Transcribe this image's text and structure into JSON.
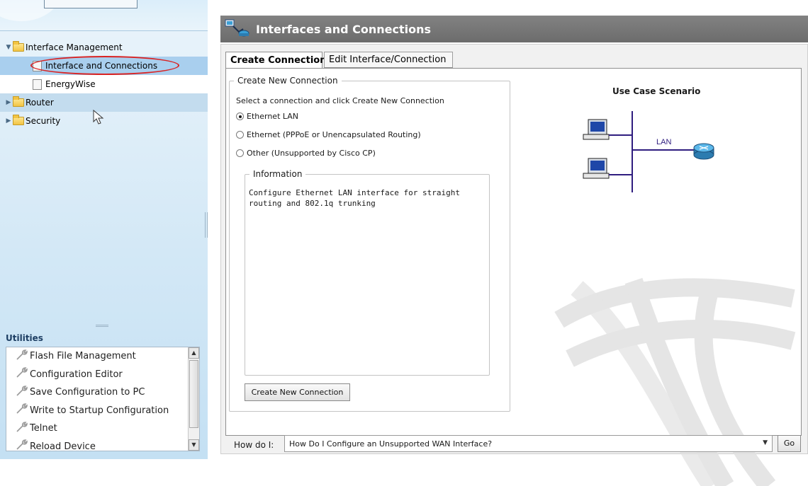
{
  "nav": {
    "tree": [
      {
        "label": "Interface Management",
        "level": 0,
        "expanded": true,
        "kind": "folder"
      },
      {
        "label": "Interface and Connections",
        "level": 1,
        "selected": true,
        "kind": "page"
      },
      {
        "label": "EnergyWise",
        "level": 1,
        "kind": "page"
      },
      {
        "label": "Router",
        "level": 0,
        "expanded": false,
        "kind": "folder"
      },
      {
        "label": "Security",
        "level": 0,
        "expanded": false,
        "kind": "folder"
      }
    ],
    "utilities": {
      "title": "Utilities",
      "items": [
        "Flash File Management",
        "Configuration Editor",
        "Save Configuration to PC",
        "Write to Startup Configuration",
        "Telnet",
        "Reload Device"
      ]
    }
  },
  "page": {
    "title": "Interfaces and Connections",
    "tabs": [
      "Create Connection",
      "Edit Interface/Connection"
    ],
    "active_tab": "Create Connection"
  },
  "create": {
    "group_title": "Create New Connection",
    "instruction": "Select a connection and click Create New Connection",
    "options": [
      {
        "label": "Ethernet LAN",
        "selected": true
      },
      {
        "label": "Ethernet (PPPoE or Unencapsulated Routing)",
        "selected": false
      },
      {
        "label": "Other (Unsupported by Cisco CP)",
        "selected": false
      }
    ],
    "info_title": "Information",
    "info_text": "Configure Ethernet LAN interface for straight routing and 802.1q trunking",
    "button": "Create New Connection"
  },
  "scenario": {
    "title": "Use Case Scenario",
    "lan_label": "LAN"
  },
  "howdoi": {
    "label": "How do I:",
    "value": "How Do I Configure an Unsupported WAN Interface?",
    "go": "Go"
  },
  "colors": {
    "banner": "#767676",
    "selection": "#a9cfee",
    "annotation": "#d92323",
    "diagram_line": "#2f1d7f",
    "router": "#3a9fd6"
  }
}
